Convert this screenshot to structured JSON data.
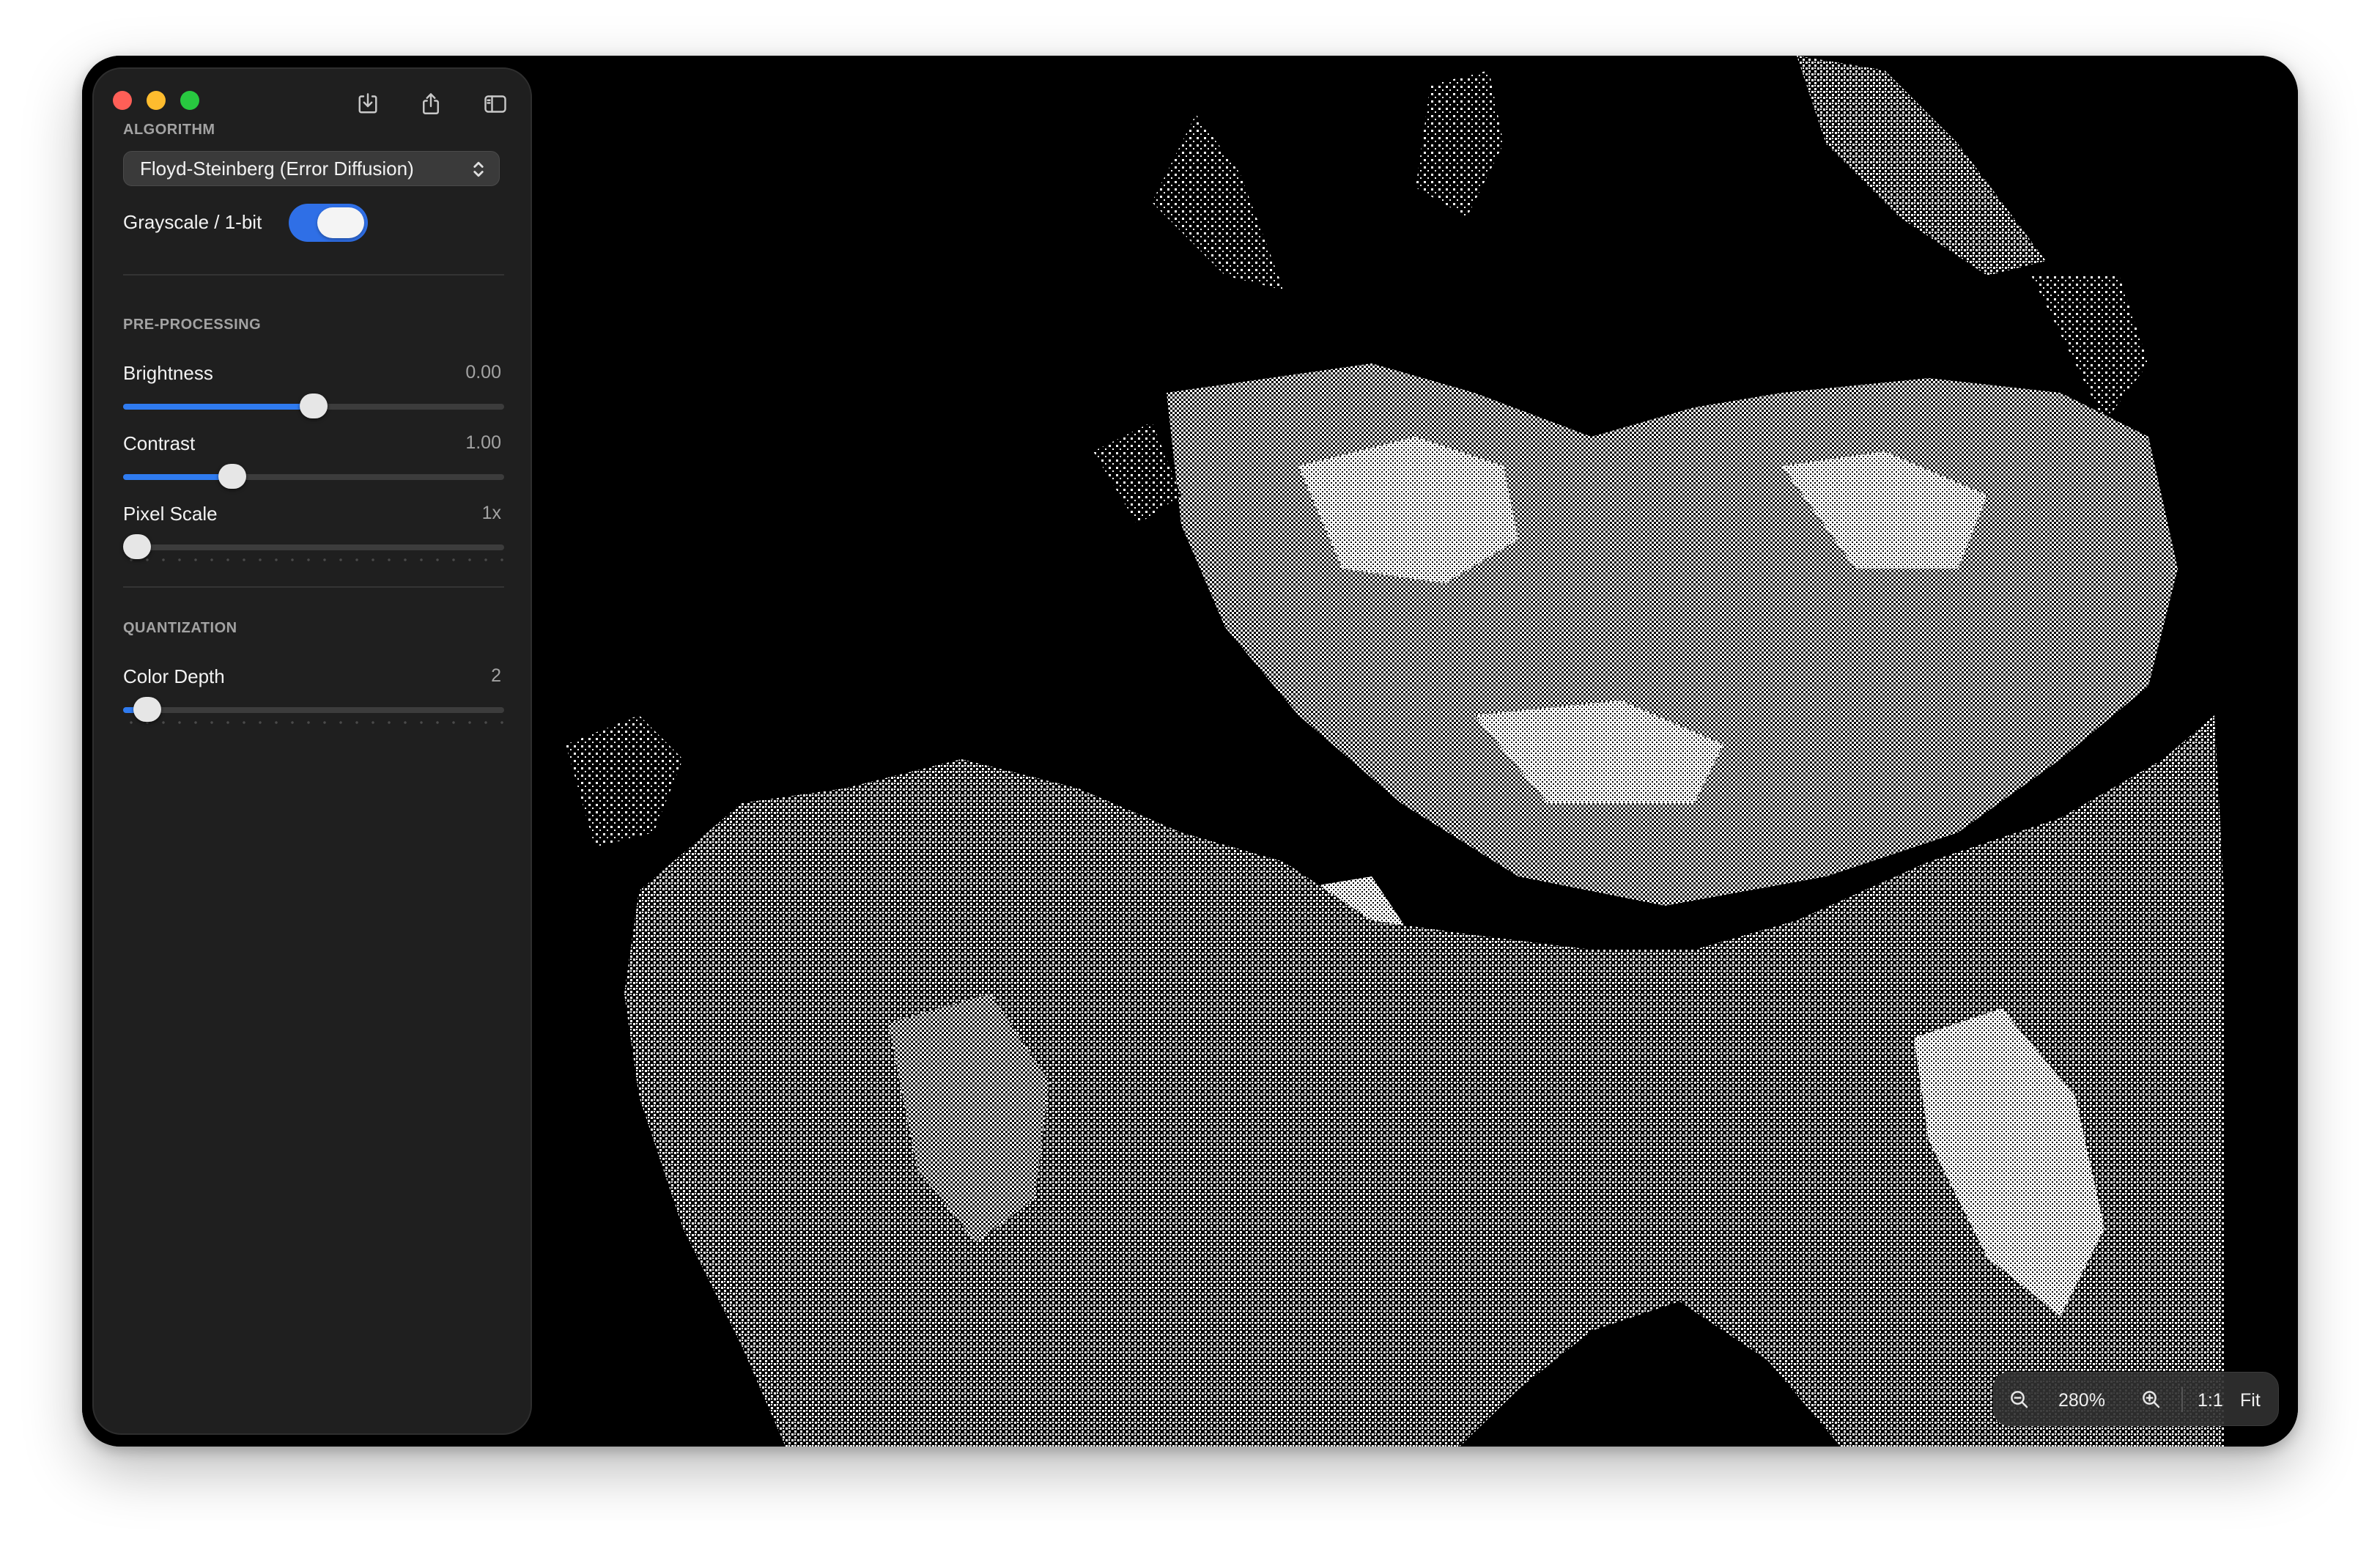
{
  "window": {
    "traffic_lights": [
      "close",
      "minimize",
      "zoom"
    ]
  },
  "toolbar": {
    "icons": [
      "import-icon",
      "share-icon",
      "sidebar-toggle-icon"
    ]
  },
  "algorithm": {
    "section_title": "ALGORITHM",
    "selected": "Floyd-Steinberg (Error Diffusion)",
    "grayscale_label": "Grayscale / 1-bit",
    "grayscale_on": true
  },
  "preprocessing": {
    "section_title": "PRE-PROCESSING",
    "brightness": {
      "label": "Brightness",
      "value_text": "0.00",
      "fraction": 0.5
    },
    "contrast": {
      "label": "Contrast",
      "value_text": "1.00",
      "fraction": 0.27
    },
    "pixel_scale": {
      "label": "Pixel Scale",
      "value_text": "1x",
      "fraction": 0.0
    }
  },
  "quantization": {
    "section_title": "QUANTIZATION",
    "color_depth": {
      "label": "Color Depth",
      "value_text": "2",
      "fraction": 0.03
    }
  },
  "zoom": {
    "level": "280%",
    "actual_size_label": "1:1",
    "fit_label": "Fit"
  },
  "colors": {
    "accent": "#2f7bf0",
    "sidebar_bg": "#1f1f1f",
    "canvas_bg": "#000000"
  }
}
